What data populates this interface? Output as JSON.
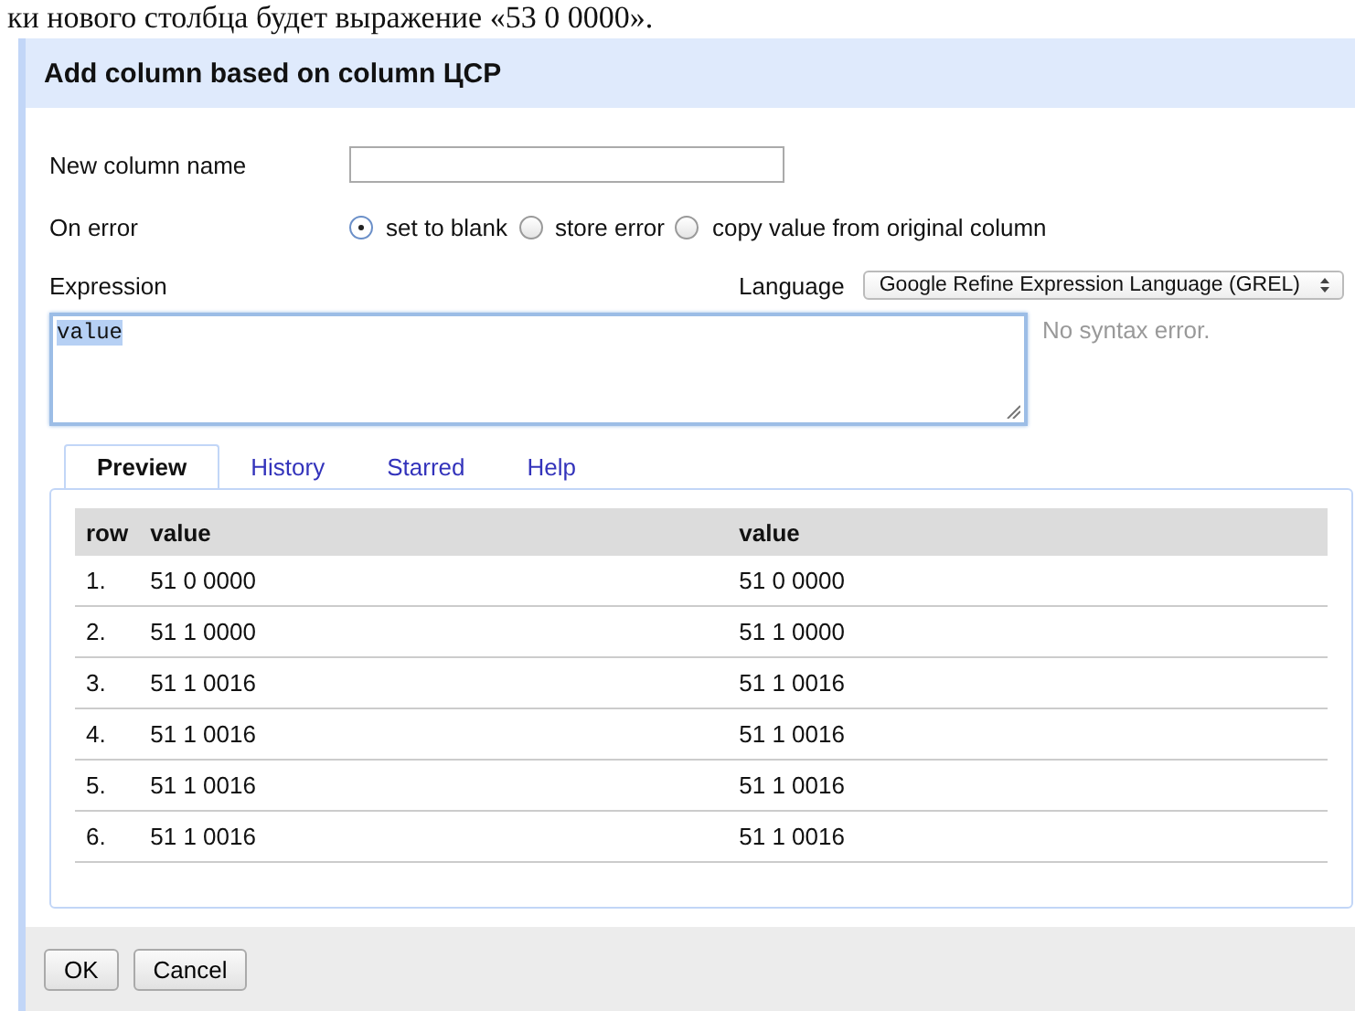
{
  "page_text": "ки нового столбца будет выражение «53 0 0000».",
  "dialog": {
    "title": "Add column based on column ЦСР"
  },
  "form": {
    "name_label": "New column name",
    "on_error": {
      "label": "On error",
      "options": [
        {
          "label": "set to blank",
          "selected": true
        },
        {
          "label": "store error",
          "selected": false
        },
        {
          "label": "copy value from original column",
          "selected": false
        }
      ]
    },
    "expression": {
      "label": "Expression",
      "value": "value",
      "selected": true
    },
    "language": {
      "label": "Language",
      "value": "Google Refine Expression Language (GREL)"
    },
    "status": "No syntax error."
  },
  "tabs": [
    {
      "label": "Preview",
      "selected": true
    },
    {
      "label": "History",
      "selected": false
    },
    {
      "label": "Starred",
      "selected": false
    },
    {
      "label": "Help",
      "selected": false
    }
  ],
  "table": {
    "columns": [
      "row",
      "value",
      "value"
    ],
    "rows": [
      [
        "1.",
        "51 0 0000",
        "51 0 0000"
      ],
      [
        "2.",
        "51 1 0000",
        "51 1 0000"
      ],
      [
        "3.",
        "51 1 0016",
        "51 1 0016"
      ],
      [
        "4.",
        "51 1 0016",
        "51 1 0016"
      ],
      [
        "5.",
        "51 1 0016",
        "51 1 0016"
      ],
      [
        "6.",
        "51 1 0016",
        "51 1 0016"
      ]
    ]
  },
  "buttons": [
    "OK",
    "Cancel"
  ]
}
